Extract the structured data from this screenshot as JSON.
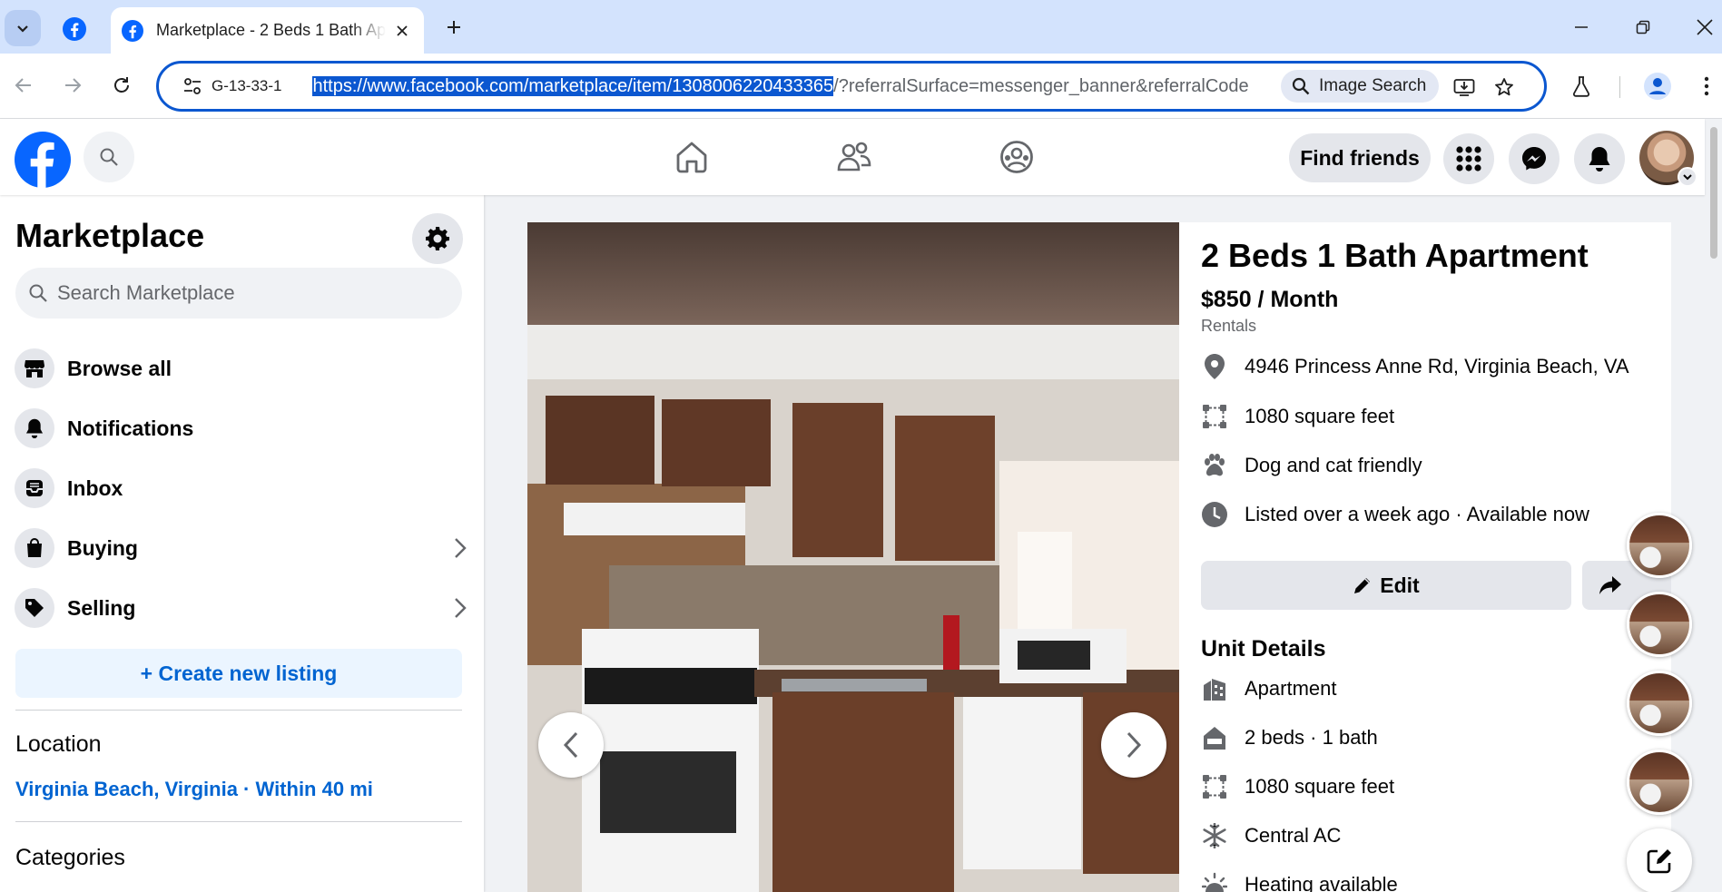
{
  "browser": {
    "tab_title": "Marketplace - 2 Beds 1 Bath Ap",
    "site_chip": "G-13-33-1",
    "url_selected": "https://www.facebook.com/marketplace/item/1308006220433365",
    "url_rest": "/?referralSurface=messenger_banner&referralCode",
    "image_search_label": "Image Search"
  },
  "header": {
    "find_friends_label": "Find friends"
  },
  "sidebar": {
    "title": "Marketplace",
    "search_placeholder": "Search Marketplace",
    "items": [
      {
        "label": "Browse all",
        "icon": "storefront-icon"
      },
      {
        "label": "Notifications",
        "icon": "bell-icon"
      },
      {
        "label": "Inbox",
        "icon": "inbox-icon"
      },
      {
        "label": "Buying",
        "icon": "shopping-bag-icon"
      },
      {
        "label": "Selling",
        "icon": "price-tag-icon"
      }
    ],
    "create_label": "+ Create new listing",
    "location_heading": "Location",
    "location_value": "Virginia Beach, Virginia · Within 40 mi",
    "categories_heading": "Categories"
  },
  "listing": {
    "title": "2 Beds 1 Bath Apartment",
    "price": "$850 / Month",
    "category": "Rentals",
    "facts": [
      {
        "icon": "location-pin-icon",
        "text": "4946 Princess Anne Rd, Virginia Beach, VA"
      },
      {
        "icon": "square-feet-icon",
        "text": "1080 square feet"
      },
      {
        "icon": "paw-icon",
        "text": "Dog and cat friendly"
      },
      {
        "icon": "clock-icon",
        "text": "Listed over a week ago · Available now"
      }
    ],
    "edit_label": "Edit",
    "unit_details_heading": "Unit Details",
    "unit_details": [
      {
        "icon": "building-icon",
        "text": "Apartment"
      },
      {
        "icon": "house-icon",
        "text": "2 beds · 1 bath"
      },
      {
        "icon": "square-feet-icon",
        "text": "1080 square feet"
      },
      {
        "icon": "snowflake-icon",
        "text": "Central AC"
      },
      {
        "icon": "heater-icon",
        "text": "Heating available"
      }
    ]
  },
  "colors": {
    "facebook_blue": "#0866ff",
    "chrome_tab_strip": "#d3e3fd",
    "link_blue": "#0064d1",
    "selection_blue": "#0b57d0"
  }
}
